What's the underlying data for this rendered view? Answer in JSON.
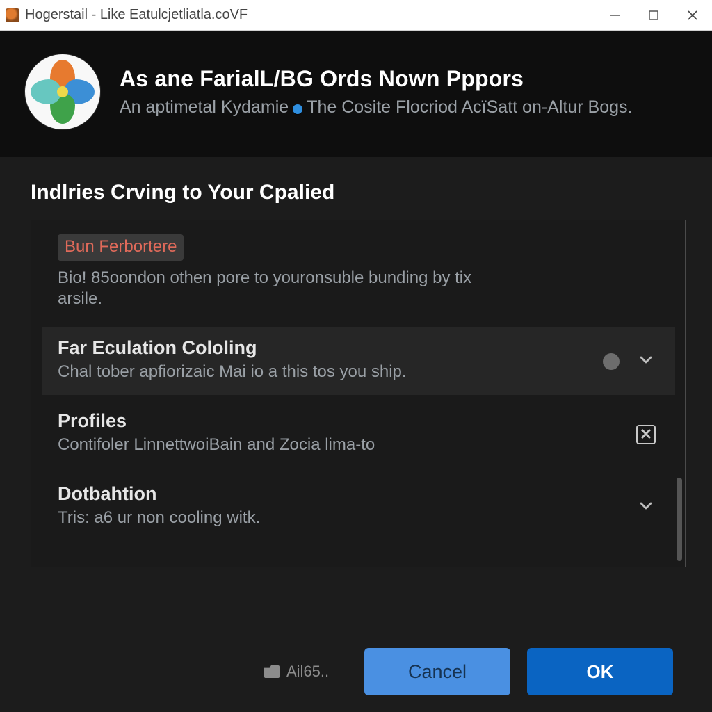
{
  "window": {
    "title": "Hogerstail - Like Eatulcjetliatla.coVF"
  },
  "header": {
    "title": "As ane FarialL/BG Ords Nown Pppors",
    "subtitle_left": "An aptimetal Kydamie",
    "subtitle_right": "The Cosite Flocriod AcïSatt on-Altur Bogs."
  },
  "section": {
    "heading": "Indlries Crving to Your Cpalied"
  },
  "list": [
    {
      "pill": "Bun Ferbortere",
      "title": "",
      "desc": "Bio! 85oondon othen pore to youronsuble bunding by tix arsile.",
      "trailing": "none"
    },
    {
      "title": "Far Eculation Cololing",
      "desc": "Chal tober apfiorizaic Mai io a this tos you ship.",
      "trailing": "dot-chevron"
    },
    {
      "title": "Profiles",
      "desc": "Contifoler LinnettwoiBain and Zocia lima-to",
      "trailing": "xbox"
    },
    {
      "title": "Dotbahtion",
      "desc": "Tris: a6 ur non cooling witk.",
      "trailing": "chevron"
    }
  ],
  "footer": {
    "hint": "Ail65..",
    "cancel": "Cancel",
    "ok": "OK"
  }
}
